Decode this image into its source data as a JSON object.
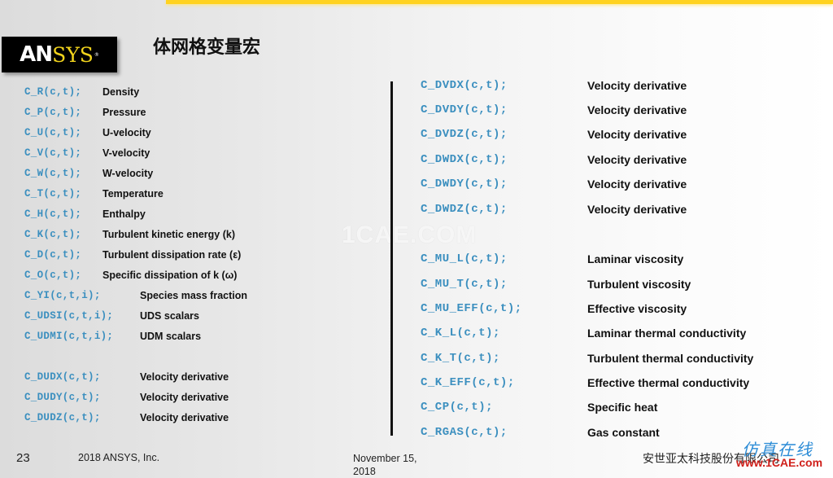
{
  "header": {
    "logo_primary": "AN",
    "logo_secondary": "SYS",
    "logo_mark": "®",
    "title": "体网格变量宏"
  },
  "left_column": [
    {
      "macro": "C_R(c,t);",
      "description": "Density"
    },
    {
      "macro": "C_P(c,t);",
      "description": "Pressure"
    },
    {
      "macro": "C_U(c,t);",
      "description": "U-velocity"
    },
    {
      "macro": "C_V(c,t);",
      "description": "V-velocity"
    },
    {
      "macro": "C_W(c,t);",
      "description": "W-velocity"
    },
    {
      "macro": "C_T(c,t);",
      "description": "Temperature"
    },
    {
      "macro": "C_H(c,t);",
      "description": "Enthalpy"
    },
    {
      "macro": "C_K(c,t);",
      "description": "Turbulent kinetic energy (k)"
    },
    {
      "macro": "C_D(c,t);",
      "description": "Turbulent dissipation rate (ε)"
    },
    {
      "macro": "C_O(c,t);",
      "description": "Specific dissipation of k (ω)"
    },
    {
      "macro": "C_YI(c,t,i);",
      "description": "Species mass fraction"
    },
    {
      "macro": "C_UDSI(c,t,i);",
      "description": "UDS scalars"
    },
    {
      "macro": "C_UDMI(c,t,i);",
      "description": "UDM scalars"
    },
    {
      "macro": "C_DUDX(c,t);",
      "description": "Velocity derivative"
    },
    {
      "macro": "C_DUDY(c,t);",
      "description": "Velocity derivative"
    },
    {
      "macro": "C_DUDZ(c,t);",
      "description": "Velocity derivative"
    }
  ],
  "right_column": [
    {
      "macro": "C_DVDX(c,t);",
      "description": "Velocity derivative"
    },
    {
      "macro": "C_DVDY(c,t);",
      "description": "Velocity derivative"
    },
    {
      "macro": "C_DVDZ(c,t);",
      "description": "Velocity derivative"
    },
    {
      "macro": "C_DWDX(c,t);",
      "description": "Velocity derivative"
    },
    {
      "macro": "C_DWDY(c,t);",
      "description": "Velocity derivative"
    },
    {
      "macro": "C_DWDZ(c,t);",
      "description": "Velocity derivative"
    },
    {
      "macro": "C_MU_L(c,t);",
      "description": "Laminar viscosity"
    },
    {
      "macro": "C_MU_T(c,t);",
      "description": "Turbulent viscosity"
    },
    {
      "macro": "C_MU_EFF(c,t);",
      "description": "Effective viscosity"
    },
    {
      "macro": "C_K_L(c,t);",
      "description": "Laminar thermal conductivity"
    },
    {
      "macro": "C_K_T(c,t);",
      "description": "Turbulent thermal conductivity"
    },
    {
      "macro": "C_K_EFF(c,t);",
      "description": "Effective thermal conductivity"
    },
    {
      "macro": "C_CP(c,t);",
      "description": "Specific heat"
    },
    {
      "macro": "C_RGAS(c,t);",
      "description": "Gas constant"
    }
  ],
  "watermark": "1CAE.COM",
  "footer": {
    "page_number": "23",
    "copyright": "2018  ANSYS, Inc.",
    "date": "November 15, 2018",
    "company": "安世亚太科技股份有限公司"
  },
  "site_watermark": {
    "chinese": "仿真在线",
    "url": "www.1CAE.com"
  },
  "colors": {
    "accent_bar": "#ffd21f",
    "macro_text": "#3b8fbf",
    "logo_yellow": "#f1d31c"
  }
}
